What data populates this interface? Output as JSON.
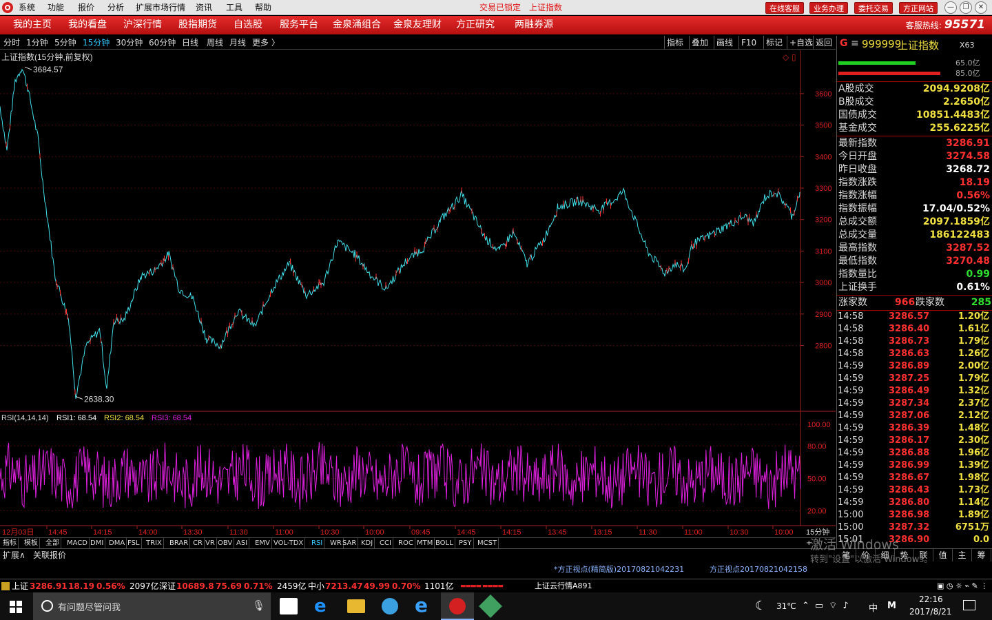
{
  "titlebar": {
    "menus": [
      "系统",
      "功能",
      "报价",
      "分析",
      "扩展市场行情",
      "资讯",
      "工具",
      "帮助"
    ],
    "status_locked": "交易已锁定",
    "current_stock": "上证指数",
    "buttons": [
      "在线客服",
      "业务办理",
      "委托交易",
      "方正网站"
    ]
  },
  "nav": {
    "items": [
      "我的主页",
      "我的看盘",
      "沪深行情",
      "股指期货",
      "自选股",
      "服务平台",
      "金泉涌组合",
      "金泉友理财",
      "方正研究",
      "两融券源"
    ],
    "hotline_label": "客服热线:",
    "hotline_number": "95571"
  },
  "timeframes": {
    "items": [
      "分时",
      "1分钟",
      "5分钟",
      "15分钟",
      "30分钟",
      "60分钟",
      "日线",
      "周线",
      "月线",
      "更多 〉"
    ],
    "active": "15分钟"
  },
  "chart_tools": [
    "指标",
    "叠加",
    "画线",
    "F10",
    "标记",
    "+自选",
    "返回"
  ],
  "chart_data": {
    "type": "line",
    "title": "上证指数(15分钟,前复权)",
    "price_axis": {
      "ticks": [
        3600,
        3500,
        3400,
        3300,
        3200,
        3100,
        3000,
        2900,
        2800
      ],
      "range": [
        2600,
        3720
      ]
    },
    "max_label": "3684.57",
    "min_label": "2638.30",
    "series": [
      {
        "name": "price",
        "anchors": [
          [
            0,
            3560
          ],
          [
            10,
            3420
          ],
          [
            22,
            3640
          ],
          [
            32,
            3684
          ],
          [
            40,
            3620
          ],
          [
            55,
            3460
          ],
          [
            62,
            3320
          ],
          [
            80,
            3020
          ],
          [
            100,
            2880
          ],
          [
            110,
            2640
          ],
          [
            125,
            2800
          ],
          [
            145,
            2850
          ],
          [
            155,
            2660
          ],
          [
            165,
            2880
          ],
          [
            180,
            2880
          ],
          [
            205,
            3020
          ],
          [
            225,
            3040
          ],
          [
            245,
            3090
          ],
          [
            260,
            2980
          ],
          [
            280,
            2950
          ],
          [
            300,
            2820
          ],
          [
            320,
            2800
          ],
          [
            345,
            2910
          ],
          [
            370,
            2860
          ],
          [
            395,
            2980
          ],
          [
            420,
            3060
          ],
          [
            445,
            2960
          ],
          [
            470,
            3000
          ],
          [
            490,
            3130
          ],
          [
            515,
            3090
          ],
          [
            540,
            3020
          ],
          [
            560,
            2980
          ],
          [
            590,
            3070
          ],
          [
            615,
            3110
          ],
          [
            640,
            3200
          ],
          [
            660,
            3250
          ],
          [
            670,
            3280
          ],
          [
            690,
            3200
          ],
          [
            705,
            3140
          ],
          [
            725,
            3100
          ],
          [
            745,
            3160
          ],
          [
            765,
            3060
          ],
          [
            790,
            3140
          ],
          [
            810,
            3240
          ],
          [
            840,
            3260
          ],
          [
            870,
            3230
          ],
          [
            890,
            3260
          ],
          [
            905,
            3290
          ],
          [
            920,
            3210
          ],
          [
            940,
            3100
          ],
          [
            965,
            3030
          ],
          [
            980,
            3060
          ],
          [
            995,
            3040
          ],
          [
            1005,
            3120
          ],
          [
            1030,
            3150
          ],
          [
            1055,
            3180
          ],
          [
            1080,
            3210
          ],
          [
            1095,
            3190
          ],
          [
            1110,
            3270
          ],
          [
            1125,
            3290
          ],
          [
            1140,
            3250
          ],
          [
            1150,
            3210
          ],
          [
            1161,
            3287
          ]
        ]
      }
    ],
    "time_labels": [
      "12月03日",
      "14:45",
      "14:15",
      "14:00",
      "13:30",
      "11:30",
      "11:00",
      "10:30",
      "10:00",
      "09:45",
      "14:45",
      "14:15",
      "13:45",
      "13:15",
      "11:30",
      "11:00",
      "10:30",
      "10:00",
      "15分钟"
    ],
    "rsi": {
      "header": "RSI(14,14,14)",
      "rsi1_label": "RSI1: 68.54",
      "rsi2_label": "RSI2: 68.54",
      "rsi3_label": "RSI3: 68.54",
      "ticks": [
        100,
        80,
        50,
        20
      ],
      "range": [
        10,
        102
      ]
    }
  },
  "indicators": [
    "指标",
    "模板",
    "全部",
    "MACD",
    "DMI",
    "DMA",
    "FSL",
    "TRIX",
    "BRAR",
    "CR",
    "VR",
    "OBV",
    "ASI",
    "EMV",
    "VOL-TDX",
    "RSI",
    "WR",
    "SAR",
    "KDJ",
    "CCI",
    "ROC",
    "MTM",
    "BOLL",
    "PSY",
    "MCST"
  ],
  "active_indicator": "RSI",
  "ext_tabs": [
    "扩展∧",
    "关联报价"
  ],
  "news": [
    "*方正视点(精简版)20170821042231",
    "方正视点20170821042158"
  ],
  "panel": {
    "code": "999999",
    "name": "上证指数",
    "tag": "X63",
    "ratio1": "65.0亿",
    "ratio2": "85.0亿",
    "turnover": [
      [
        "A股成交",
        "2094.9208亿"
      ],
      [
        "B股成交",
        "2.2650亿"
      ],
      [
        "国债成交",
        "10851.4483亿"
      ],
      [
        "基金成交",
        "255.6225亿"
      ]
    ],
    "quote": [
      [
        "最新指数",
        "3286.91",
        "red"
      ],
      [
        "今日开盘",
        "3274.58",
        "red"
      ],
      [
        "昨日收盘",
        "3268.72",
        "wht"
      ],
      [
        "指数涨跌",
        "18.19",
        "red"
      ],
      [
        "指数涨幅",
        "0.56%",
        "red"
      ],
      [
        "指数振幅",
        "17.04/0.52%",
        "wht"
      ],
      [
        "总成交额",
        "2097.1859亿",
        "yel"
      ],
      [
        "总成交量",
        "186122483",
        "yel"
      ],
      [
        "最高指数",
        "3287.52",
        "red"
      ],
      [
        "最低指数",
        "3270.48",
        "red"
      ],
      [
        "指数量比",
        "0.99",
        "grn"
      ],
      [
        "上证换手",
        "0.61%",
        "wht"
      ]
    ],
    "up_label": "涨家数",
    "up_count": "966",
    "down_label": "跌家数",
    "down_count": "285",
    "ticks": [
      [
        "14:58",
        "3286.57",
        "1.20亿"
      ],
      [
        "14:58",
        "3286.40",
        "1.61亿"
      ],
      [
        "14:58",
        "3286.73",
        "1.79亿"
      ],
      [
        "14:58",
        "3286.63",
        "1.26亿"
      ],
      [
        "14:59",
        "3286.89",
        "2.00亿"
      ],
      [
        "14:59",
        "3287.25",
        "1.79亿"
      ],
      [
        "14:59",
        "3286.49",
        "1.32亿"
      ],
      [
        "14:59",
        "3287.34",
        "2.37亿"
      ],
      [
        "14:59",
        "3287.06",
        "2.12亿"
      ],
      [
        "14:59",
        "3286.39",
        "1.48亿"
      ],
      [
        "14:59",
        "3286.17",
        "2.30亿"
      ],
      [
        "14:59",
        "3286.88",
        "1.96亿"
      ],
      [
        "14:59",
        "3286.99",
        "1.39亿"
      ],
      [
        "14:59",
        "3286.67",
        "1.98亿"
      ],
      [
        "14:59",
        "3286.43",
        "1.73亿"
      ],
      [
        "14:59",
        "3286.80",
        "1.14亿"
      ],
      [
        "15:00",
        "3286.98",
        "1.89亿"
      ],
      [
        "15:00",
        "3287.32",
        "6751万"
      ],
      [
        "15:01",
        "3286.90",
        "0.0"
      ]
    ],
    "bottom_tabs": [
      "笔",
      "价",
      "细",
      "势",
      "联",
      "值",
      "主",
      "筹"
    ]
  },
  "status": {
    "sh_label": "上证",
    "sh_value": "3286.91",
    "sh_chg": "18.19",
    "sh_pct": "0.56%",
    "sh_amt": "2097亿",
    "sz_label": "深证",
    "sz_value": "10689.8",
    "sz_chg": "75.69",
    "sz_pct": "0.71%",
    "sz_amt": "2459亿",
    "zx_label": "中小",
    "zx_value": "7213.47",
    "zx_chg": "49.99",
    "zx_pct": "0.70%",
    "zx_amt": "1101亿",
    "cloud": "上证云行情A891"
  },
  "taskbar": {
    "search_placeholder": "有问题尽管问我",
    "weather": "31℃",
    "ime": "中",
    "time": "22:16",
    "date": "2017/8/21"
  },
  "watermark": {
    "line1": "激活 Windows",
    "line2": "转到\"设置\"以激活 Windows。"
  }
}
